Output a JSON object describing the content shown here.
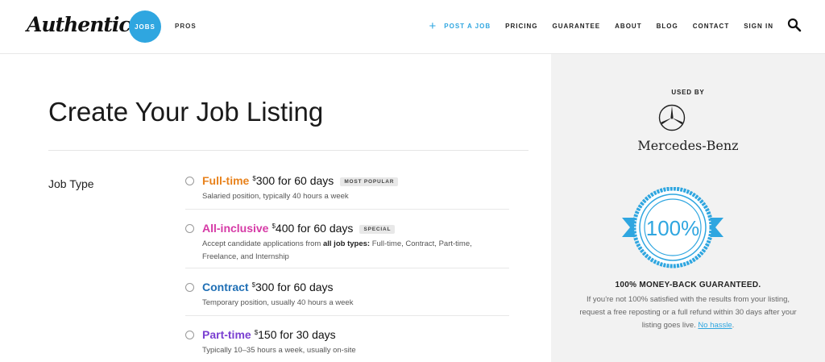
{
  "header": {
    "logo": "Authentic",
    "jobs_label": "JOBS",
    "pros_label": "PROS",
    "nav": {
      "post_a_job": "POST A JOB",
      "pricing": "PRICING",
      "guarantee": "GUARANTEE",
      "about": "ABOUT",
      "blog": "BLOG",
      "contact": "CONTACT",
      "sign_in": "SIGN IN"
    },
    "accent_color": "#2fa6e0"
  },
  "main": {
    "title": "Create Your Job Listing",
    "job_type_label": "Job Type",
    "options": [
      {
        "name": "Full-time",
        "currency": "$",
        "price": "300 for 60 days",
        "badge": "MOST POPULAR",
        "desc": "Salaried position, typically 40 hours a week",
        "color": "#e8821c"
      },
      {
        "name": "All-inclusive",
        "currency": "$",
        "price": "400 for 60 days",
        "badge": "SPECIAL",
        "desc_pre": "Accept candidate applications from ",
        "desc_bold": "all job types:",
        "desc_post": " Full-time, Contract, Part-time, Freelance, and Internship",
        "color": "#d63aa6"
      },
      {
        "name": "Contract",
        "currency": "$",
        "price": "300 for 60 days",
        "desc": "Temporary position, usually 40 hours a week",
        "color": "#1f6fb5"
      },
      {
        "name": "Part-time",
        "currency": "$",
        "price": "150 for 30 days",
        "desc": "Typically 10–35 hours a week, usually on-site",
        "color": "#7a3fd1"
      }
    ]
  },
  "sidebar": {
    "used_by": "USED BY",
    "brand": "Mercedes-Benz",
    "seal_text": "100%",
    "guarantee_title": "100% MONEY-BACK GUARANTEED.",
    "guarantee_text": "If you're not 100% satisfied with the results from your listing, request a free reposting or a full refund within 30 days after your listing goes live.",
    "guarantee_link": "No hassle"
  }
}
